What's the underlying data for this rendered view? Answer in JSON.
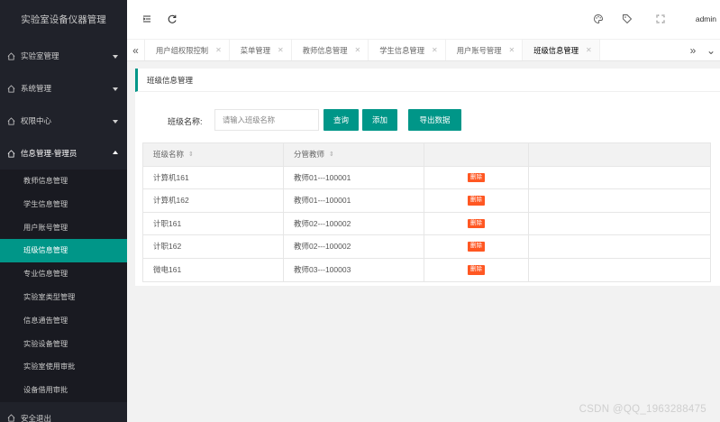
{
  "sidebar": {
    "title": "实验室设备仪器管理",
    "groups": [
      {
        "label": "实验室管理"
      },
      {
        "label": "系统管理"
      },
      {
        "label": "权限中心"
      },
      {
        "label": "信息管理-管理员"
      }
    ],
    "subitems": [
      {
        "label": "教师信息管理"
      },
      {
        "label": "学生信息管理"
      },
      {
        "label": "用户账号管理"
      },
      {
        "label": "班级信息管理"
      },
      {
        "label": "专业信息管理"
      },
      {
        "label": "实验室类型管理"
      },
      {
        "label": "信息通告管理"
      },
      {
        "label": "实验设备管理"
      },
      {
        "label": "实验室使用审批"
      },
      {
        "label": "设备借用审批"
      }
    ],
    "active_subitem": "班级信息管理",
    "last_group_label": "安全退出"
  },
  "topbar": {
    "user": "admin"
  },
  "tabs": {
    "items": [
      {
        "label": "用户组权限控制"
      },
      {
        "label": "菜单管理"
      },
      {
        "label": "教师信息管理"
      },
      {
        "label": "学生信息管理"
      },
      {
        "label": "用户账号管理"
      },
      {
        "label": "班级信息管理"
      }
    ],
    "active": "班级信息管理"
  },
  "panel": {
    "title": "班级信息管理",
    "search_label": "班级名称:",
    "search_placeholder": "请输入班级名称",
    "query_label": "查询",
    "add_label": "添加",
    "export_label": "导出数据"
  },
  "table": {
    "headers": [
      "班级名称",
      "分管教师",
      ""
    ],
    "rows": [
      {
        "name": "计算机161",
        "teacher": "教师01---100001",
        "action": "删除"
      },
      {
        "name": "计算机162",
        "teacher": "教师01---100001",
        "action": "删除"
      },
      {
        "name": "计职161",
        "teacher": "教师02---100002",
        "action": "删除"
      },
      {
        "name": "计职162",
        "teacher": "教师02---100002",
        "action": "删除"
      },
      {
        "name": "微电161",
        "teacher": "教师03---100003",
        "action": "删除"
      }
    ]
  },
  "watermark": "CSDN @QQ_1963288475",
  "colors": {
    "sidebar_bg": "#20222a",
    "accent": "#009688",
    "danger": "#ff5722"
  }
}
